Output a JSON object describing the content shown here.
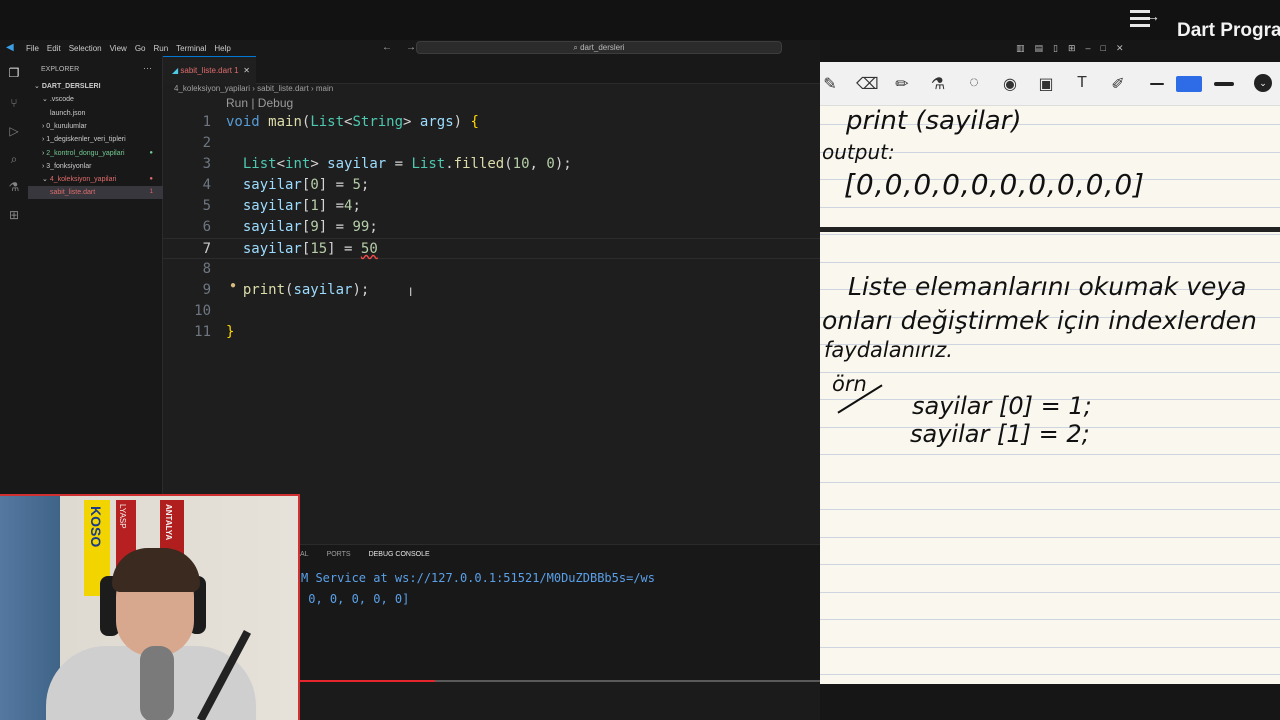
{
  "video_header": {
    "series_title": "Dart Progra"
  },
  "vscode": {
    "menu": [
      "File",
      "Edit",
      "Selection",
      "View",
      "Go",
      "Run",
      "Terminal",
      "Help"
    ],
    "search_text": "dart_dersleri",
    "explorer": {
      "header": "EXPLORER",
      "items": [
        {
          "label": "DART_DERSLERI",
          "indent": 0,
          "kind": "root"
        },
        {
          "label": ".vscode",
          "indent": 1,
          "kind": "folder"
        },
        {
          "label": "launch.json",
          "indent": 2,
          "kind": "file"
        },
        {
          "label": "0_kurulumlar",
          "indent": 1,
          "kind": "folder"
        },
        {
          "label": "1_degiskenler_veri_tipleri",
          "indent": 1,
          "kind": "folder"
        },
        {
          "label": "2_kontrol_dongu_yapilari",
          "indent": 1,
          "kind": "folder",
          "color": "#73c991"
        },
        {
          "label": "3_fonksiyonlar",
          "indent": 1,
          "kind": "folder"
        },
        {
          "label": "4_koleksiyon_yapilari",
          "indent": 1,
          "kind": "folder",
          "color": "#e06c6c"
        },
        {
          "label": "sabit_liste.dart",
          "indent": 2,
          "kind": "file",
          "color": "#e06c6c",
          "selected": true
        }
      ]
    },
    "tab": {
      "label": "sabit_liste.dart 1"
    },
    "breadcrumb": "4_koleksiyon_yapilari  ›  sabit_liste.dart  ›  main",
    "codelens": "Run | Debug",
    "code_lines": [
      {
        "n": "1",
        "html_parts": [
          [
            "kw",
            "void "
          ],
          [
            "fn",
            "main"
          ],
          [
            "",
            "("
          ],
          [
            "ty",
            "List"
          ],
          [
            "",
            "<"
          ],
          [
            "ty",
            "String"
          ],
          [
            "",
            "> "
          ],
          [
            "vr",
            "args"
          ],
          [
            "",
            ") "
          ],
          [
            "br",
            "{"
          ]
        ]
      },
      {
        "n": "2",
        "html_parts": []
      },
      {
        "n": "3",
        "html_parts": [
          [
            "",
            "  "
          ],
          [
            "ty",
            "List"
          ],
          [
            "",
            "<"
          ],
          [
            "ty",
            "int"
          ],
          [
            "",
            "> "
          ],
          [
            "vr",
            "sayilar"
          ],
          [
            "",
            " = "
          ],
          [
            "ty",
            "List"
          ],
          [
            "",
            "."
          ],
          [
            "fn",
            "filled"
          ],
          [
            "",
            "("
          ],
          [
            "nm",
            "10"
          ],
          [
            "",
            ", "
          ],
          [
            "nm",
            "0"
          ],
          [
            "",
            ");"
          ]
        ]
      },
      {
        "n": "4",
        "html_parts": [
          [
            "",
            "  "
          ],
          [
            "vr",
            "sayilar"
          ],
          [
            "",
            "["
          ],
          [
            "nm",
            "0"
          ],
          [
            "",
            "] = "
          ],
          [
            "nm",
            "5"
          ],
          [
            "",
            ";"
          ]
        ]
      },
      {
        "n": "5",
        "html_parts": [
          [
            "",
            "  "
          ],
          [
            "vr",
            "sayilar"
          ],
          [
            "",
            "["
          ],
          [
            "nm",
            "1"
          ],
          [
            "",
            "] ="
          ],
          [
            "nm",
            "4"
          ],
          [
            "",
            ";"
          ]
        ]
      },
      {
        "n": "6",
        "html_parts": [
          [
            "",
            "  "
          ],
          [
            "vr",
            "sayilar"
          ],
          [
            "",
            "["
          ],
          [
            "nm",
            "9"
          ],
          [
            "",
            "] = "
          ],
          [
            "nm",
            "99"
          ],
          [
            "",
            ";"
          ]
        ]
      },
      {
        "n": "7",
        "html_parts": [
          [
            "",
            "  "
          ],
          [
            "vr",
            "sayilar"
          ],
          [
            "",
            "["
          ],
          [
            "nm",
            "15"
          ],
          [
            "",
            "] = "
          ],
          [
            "nm err",
            "50"
          ]
        ],
        "current": true
      },
      {
        "n": "8",
        "html_parts": []
      },
      {
        "n": "9",
        "html_parts": [
          [
            "",
            "  "
          ],
          [
            "fn",
            "print"
          ],
          [
            "",
            "("
          ],
          [
            "vr",
            "sayilar"
          ],
          [
            "",
            ");"
          ]
        ]
      },
      {
        "n": "10",
        "html_parts": []
      },
      {
        "n": "11",
        "html_parts": [
          [
            "br",
            "}"
          ]
        ]
      }
    ],
    "panel_tabs": [
      "AL",
      "PORTS",
      "DEBUG CONSOLE"
    ],
    "output_lines": [
      "M Service at ws://127.0.0.1:51521/M0DuZDBBb5s=/ws",
      " 0, 0, 0, 0, 0]"
    ],
    "video_progress": 0.26
  },
  "notes": {
    "tool_icons": [
      "✎",
      "⌫",
      "✏",
      "⚗",
      "◌",
      "◉",
      "▣",
      "T",
      "✐"
    ],
    "lines": [
      {
        "text": "print (sayilar)",
        "size": 26
      },
      {
        "text": "output:",
        "size": 22
      },
      {
        "text": "[0,0,0,0,0,0,0,0,0,0]",
        "size": 28
      },
      {
        "text": "Liste elemanlarını okumak veya",
        "size": 25
      },
      {
        "text": "onları değiştirmek için indexlerden",
        "size": 25
      },
      {
        "text": "faydalanırız.",
        "size": 22
      },
      {
        "text": "örn",
        "size": 22
      },
      {
        "text": "sayilar [0] = 1;",
        "size": 24
      },
      {
        "text": "sayilar [1] = 2;",
        "size": 24
      }
    ]
  },
  "webcam": {
    "scarf_texts": [
      "KOSO",
      "LYASP",
      "ANTALYA"
    ]
  }
}
